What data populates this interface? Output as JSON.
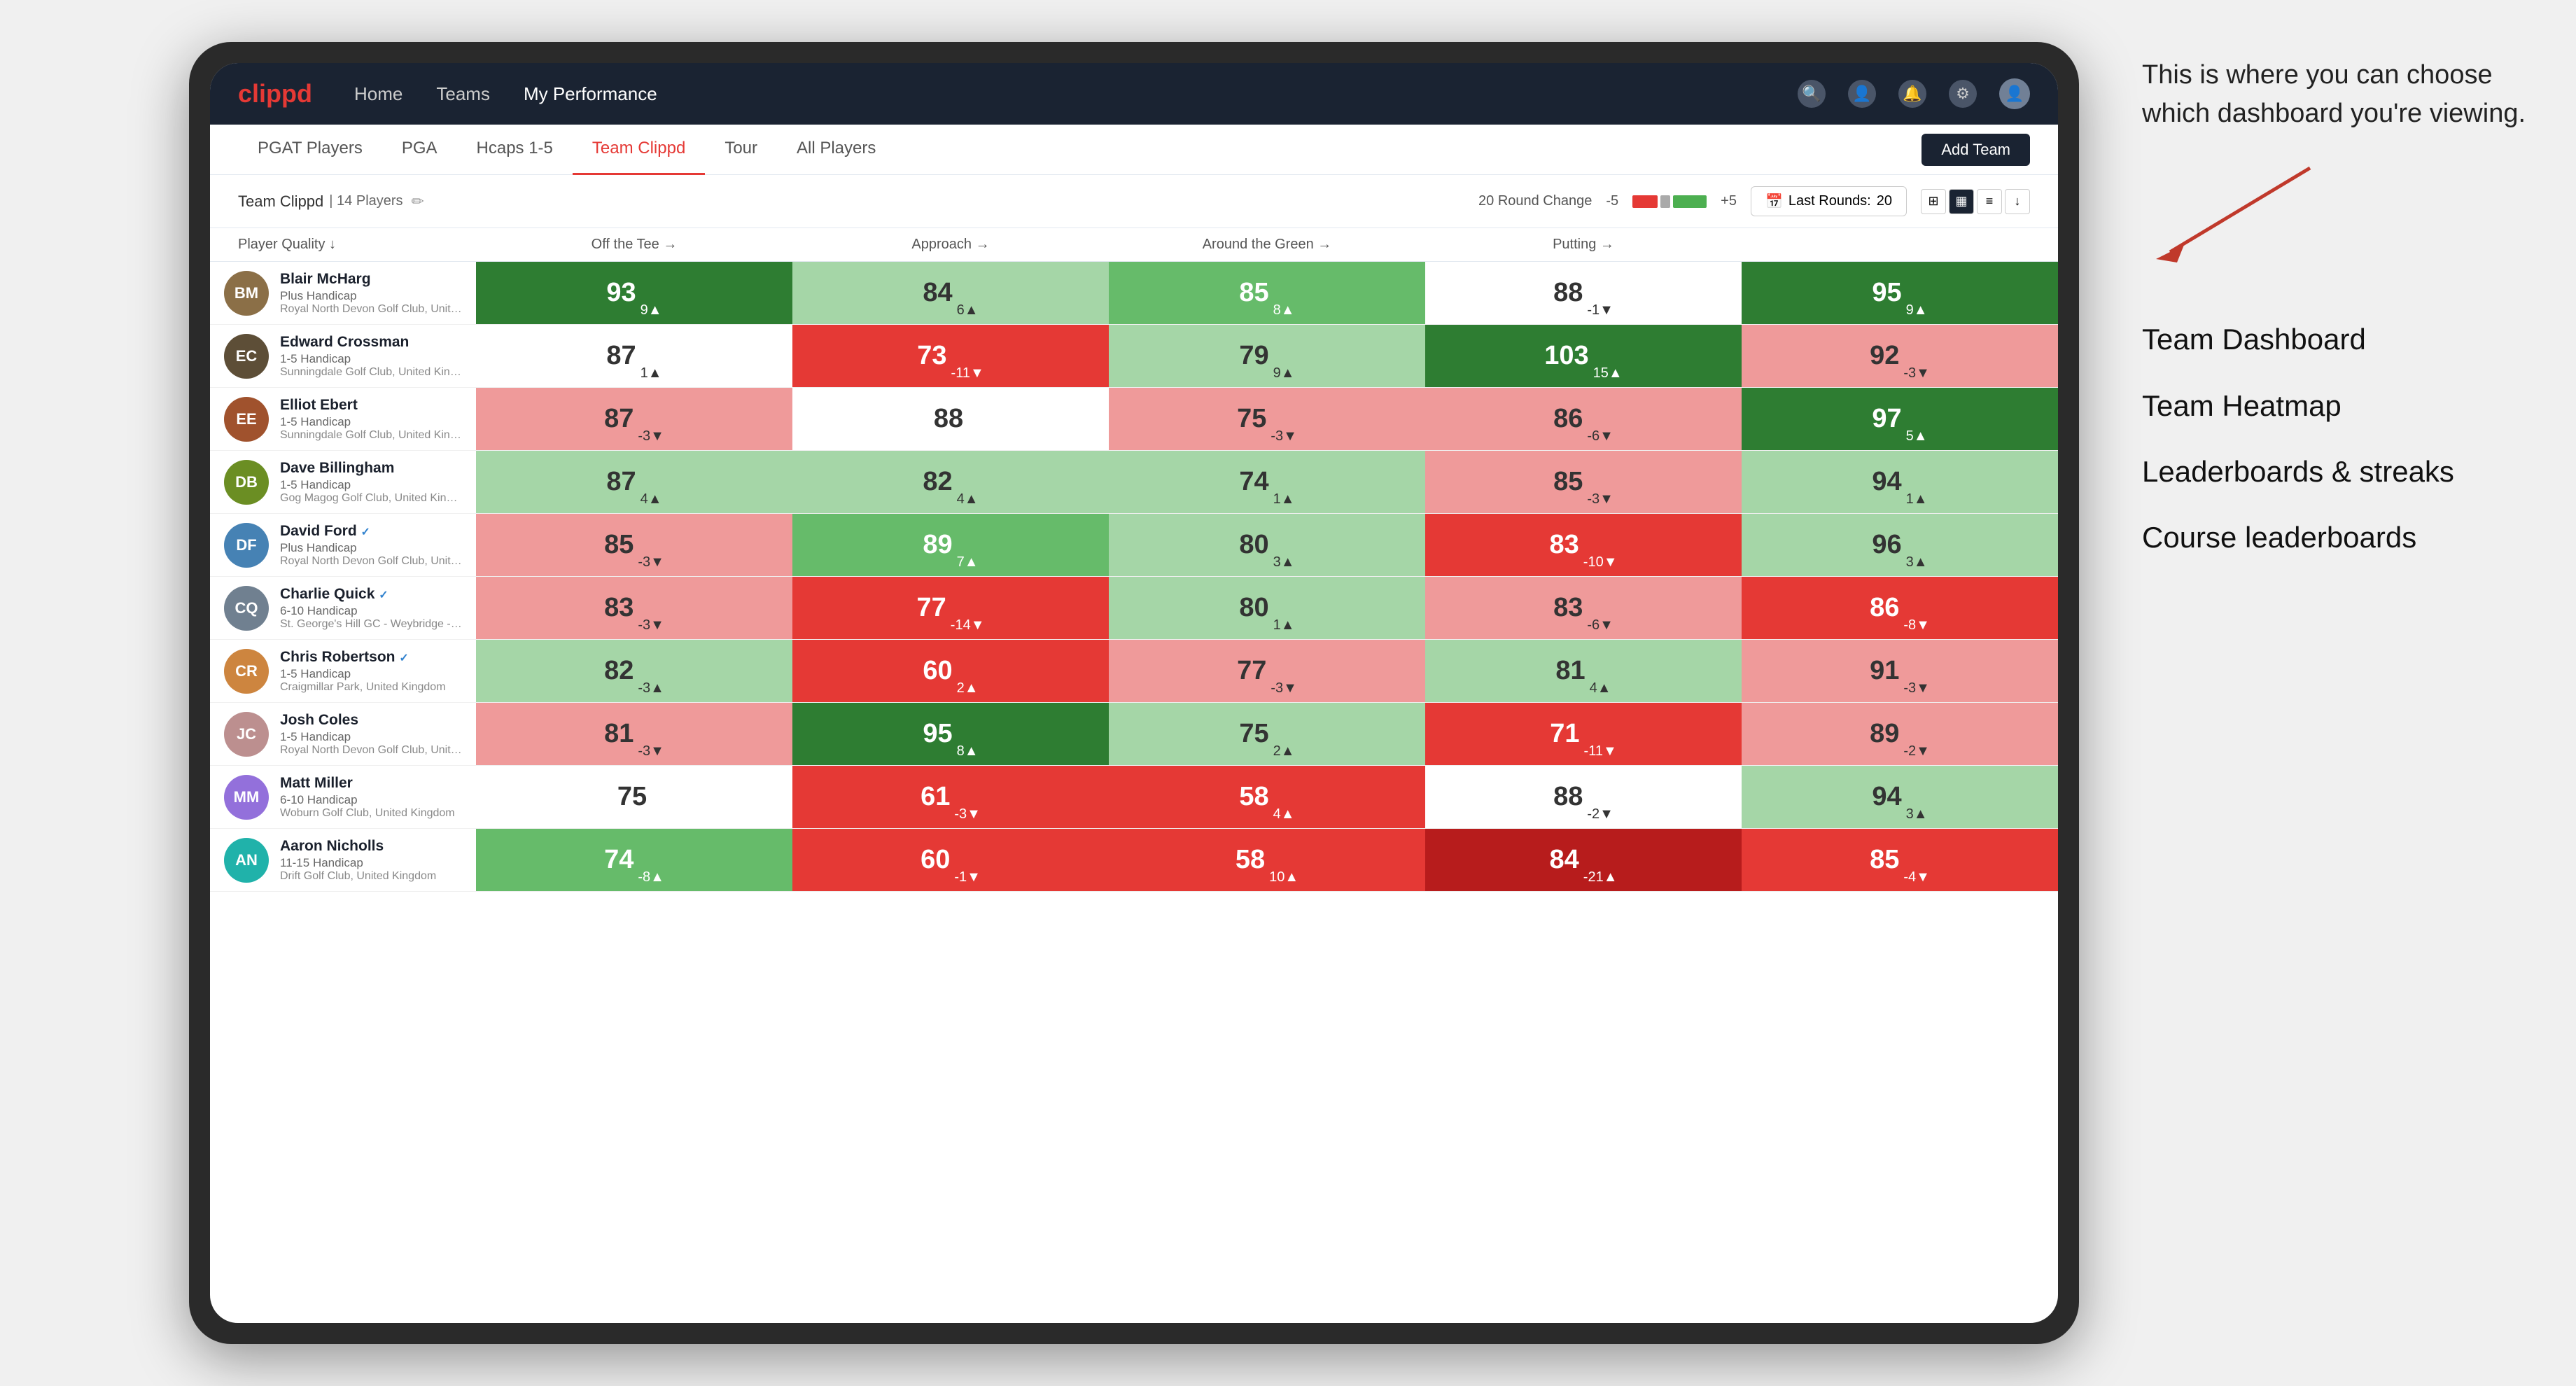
{
  "annotation": {
    "callout": "This is where you can choose which dashboard you're viewing.",
    "options": [
      "Team Dashboard",
      "Team Heatmap",
      "Leaderboards & streaks",
      "Course leaderboards"
    ]
  },
  "nav": {
    "logo": "clippd",
    "links": [
      "Home",
      "Teams",
      "My Performance"
    ],
    "active_link": "My Performance"
  },
  "sub_nav": {
    "links": [
      "PGAT Players",
      "PGA",
      "Hcaps 1-5",
      "Team Clippd",
      "Tour",
      "All Players"
    ],
    "active_link": "Team Clippd",
    "add_team_label": "Add Team"
  },
  "team_bar": {
    "team_name": "Team Clippd",
    "player_count": "14 Players",
    "round_change_label": "20 Round Change",
    "neg_label": "-5",
    "pos_label": "+5",
    "last_rounds_label": "Last Rounds:",
    "last_rounds_value": "20"
  },
  "col_headers": [
    "Player Quality ↓",
    "Off the Tee →",
    "Approach →",
    "Around the Green →",
    "Putting →"
  ],
  "players": [
    {
      "name": "Blair McHarg",
      "handicap": "Plus Handicap",
      "club": "Royal North Devon Golf Club, United Kingdom",
      "scores": [
        {
          "value": "93",
          "change": "9▲",
          "cell_class": "cell-green-dark"
        },
        {
          "value": "84",
          "change": "6▲",
          "cell_class": "cell-green-light"
        },
        {
          "value": "85",
          "change": "8▲",
          "cell_class": "cell-green-mid"
        },
        {
          "value": "88",
          "change": "-1▼",
          "cell_class": "cell-white"
        },
        {
          "value": "95",
          "change": "9▲",
          "cell_class": "cell-green-dark"
        }
      ]
    },
    {
      "name": "Edward Crossman",
      "handicap": "1-5 Handicap",
      "club": "Sunningdale Golf Club, United Kingdom",
      "scores": [
        {
          "value": "87",
          "change": "1▲",
          "cell_class": "cell-white"
        },
        {
          "value": "73",
          "change": "-11▼",
          "cell_class": "cell-red-mid"
        },
        {
          "value": "79",
          "change": "9▲",
          "cell_class": "cell-green-light"
        },
        {
          "value": "103",
          "change": "15▲",
          "cell_class": "cell-green-dark"
        },
        {
          "value": "92",
          "change": "-3▼",
          "cell_class": "cell-red-light"
        }
      ]
    },
    {
      "name": "Elliot Ebert",
      "handicap": "1-5 Handicap",
      "club": "Sunningdale Golf Club, United Kingdom",
      "scores": [
        {
          "value": "87",
          "change": "-3▼",
          "cell_class": "cell-red-light"
        },
        {
          "value": "88",
          "change": "",
          "cell_class": "cell-white"
        },
        {
          "value": "75",
          "change": "-3▼",
          "cell_class": "cell-red-light"
        },
        {
          "value": "86",
          "change": "-6▼",
          "cell_class": "cell-red-light"
        },
        {
          "value": "97",
          "change": "5▲",
          "cell_class": "cell-green-dark"
        }
      ]
    },
    {
      "name": "Dave Billingham",
      "handicap": "1-5 Handicap",
      "club": "Gog Magog Golf Club, United Kingdom",
      "scores": [
        {
          "value": "87",
          "change": "4▲",
          "cell_class": "cell-green-light"
        },
        {
          "value": "82",
          "change": "4▲",
          "cell_class": "cell-green-light"
        },
        {
          "value": "74",
          "change": "1▲",
          "cell_class": "cell-green-light"
        },
        {
          "value": "85",
          "change": "-3▼",
          "cell_class": "cell-red-light"
        },
        {
          "value": "94",
          "change": "1▲",
          "cell_class": "cell-green-light"
        }
      ]
    },
    {
      "name": "David Ford ✓",
      "handicap": "Plus Handicap",
      "club": "Royal North Devon Golf Club, United Kingdom",
      "scores": [
        {
          "value": "85",
          "change": "-3▼",
          "cell_class": "cell-red-light"
        },
        {
          "value": "89",
          "change": "7▲",
          "cell_class": "cell-green-mid"
        },
        {
          "value": "80",
          "change": "3▲",
          "cell_class": "cell-green-light"
        },
        {
          "value": "83",
          "change": "-10▼",
          "cell_class": "cell-red-mid"
        },
        {
          "value": "96",
          "change": "3▲",
          "cell_class": "cell-green-light"
        }
      ]
    },
    {
      "name": "Charlie Quick ✓",
      "handicap": "6-10 Handicap",
      "club": "St. George's Hill GC - Weybridge - Surrey, Uni...",
      "scores": [
        {
          "value": "83",
          "change": "-3▼",
          "cell_class": "cell-red-light"
        },
        {
          "value": "77",
          "change": "-14▼",
          "cell_class": "cell-red-mid"
        },
        {
          "value": "80",
          "change": "1▲",
          "cell_class": "cell-green-light"
        },
        {
          "value": "83",
          "change": "-6▼",
          "cell_class": "cell-red-light"
        },
        {
          "value": "86",
          "change": "-8▼",
          "cell_class": "cell-red-mid"
        }
      ]
    },
    {
      "name": "Chris Robertson ✓",
      "handicap": "1-5 Handicap",
      "club": "Craigmillar Park, United Kingdom",
      "scores": [
        {
          "value": "82",
          "change": "-3▲",
          "cell_class": "cell-green-light"
        },
        {
          "value": "60",
          "change": "2▲",
          "cell_class": "cell-red-mid"
        },
        {
          "value": "77",
          "change": "-3▼",
          "cell_class": "cell-red-light"
        },
        {
          "value": "81",
          "change": "4▲",
          "cell_class": "cell-green-light"
        },
        {
          "value": "91",
          "change": "-3▼",
          "cell_class": "cell-red-light"
        }
      ]
    },
    {
      "name": "Josh Coles",
      "handicap": "1-5 Handicap",
      "club": "Royal North Devon Golf Club, United Kingdom",
      "scores": [
        {
          "value": "81",
          "change": "-3▼",
          "cell_class": "cell-red-light"
        },
        {
          "value": "95",
          "change": "8▲",
          "cell_class": "cell-green-dark"
        },
        {
          "value": "75",
          "change": "2▲",
          "cell_class": "cell-green-light"
        },
        {
          "value": "71",
          "change": "-11▼",
          "cell_class": "cell-red-mid"
        },
        {
          "value": "89",
          "change": "-2▼",
          "cell_class": "cell-red-light"
        }
      ]
    },
    {
      "name": "Matt Miller",
      "handicap": "6-10 Handicap",
      "club": "Woburn Golf Club, United Kingdom",
      "scores": [
        {
          "value": "75",
          "change": "",
          "cell_class": "cell-white"
        },
        {
          "value": "61",
          "change": "-3▼",
          "cell_class": "cell-red-mid"
        },
        {
          "value": "58",
          "change": "4▲",
          "cell_class": "cell-red-mid"
        },
        {
          "value": "88",
          "change": "-2▼",
          "cell_class": "cell-white"
        },
        {
          "value": "94",
          "change": "3▲",
          "cell_class": "cell-green-light"
        }
      ]
    },
    {
      "name": "Aaron Nicholls",
      "handicap": "11-15 Handicap",
      "club": "Drift Golf Club, United Kingdom",
      "scores": [
        {
          "value": "74",
          "change": "-8▲",
          "cell_class": "cell-green-mid"
        },
        {
          "value": "60",
          "change": "-1▼",
          "cell_class": "cell-red-mid"
        },
        {
          "value": "58",
          "change": "10▲",
          "cell_class": "cell-red-mid"
        },
        {
          "value": "84",
          "change": "-21▲",
          "cell_class": "cell-red-dark"
        },
        {
          "value": "85",
          "change": "-4▼",
          "cell_class": "cell-red-mid"
        }
      ]
    }
  ],
  "icons": {
    "search": "🔍",
    "user": "👤",
    "bell": "🔔",
    "settings": "⚙",
    "chevron_down": "▾",
    "grid": "⊞",
    "list": "≡",
    "edit": "✏"
  }
}
